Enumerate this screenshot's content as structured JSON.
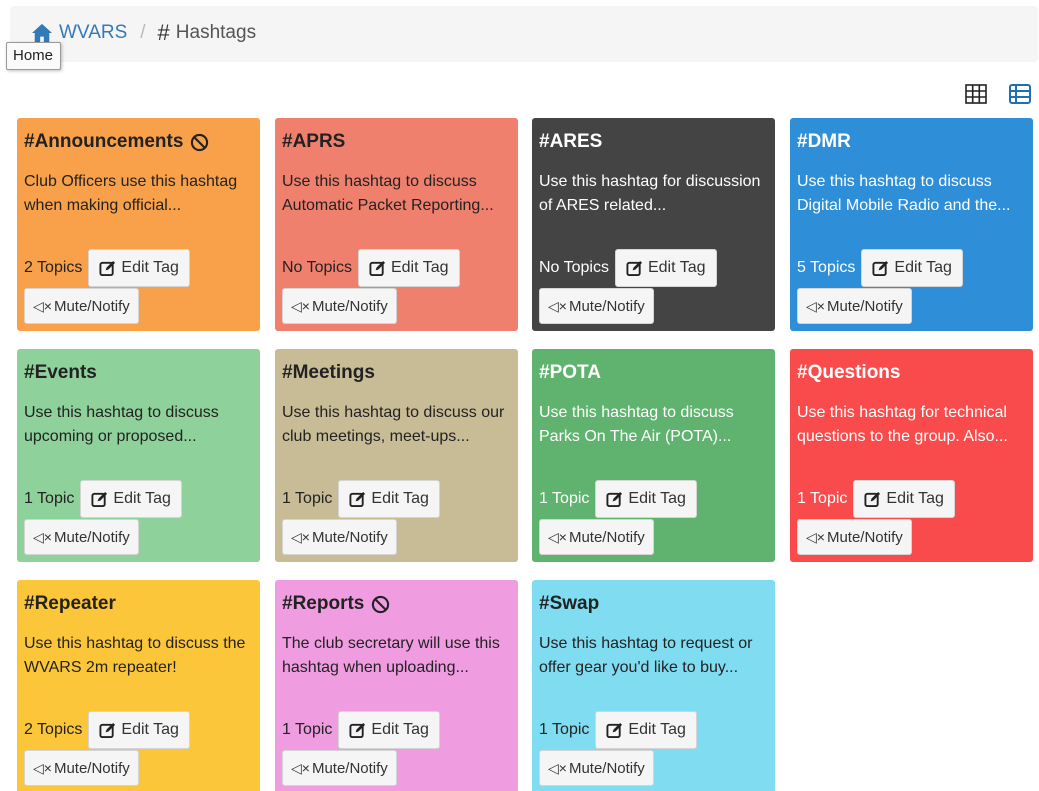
{
  "breadcrumb": {
    "home_label": "WVARS",
    "separator": "/",
    "current_label": "Hashtags"
  },
  "tooltip": {
    "text": "Home"
  },
  "view_toggle": {
    "grid_icon": "grid-icon",
    "list_icon": "list-icon",
    "active_color": "#1f6fb5"
  },
  "buttons": {
    "edit_label": "Edit Tag",
    "mute_label": "Mute/Notify"
  },
  "tags": [
    {
      "title": "#Announcements",
      "restricted": true,
      "desc": "Club Officers use this hashtag when making official...",
      "count": "2 Topics",
      "bg": "#f9a04a",
      "text_color": "#222222"
    },
    {
      "title": "#APRS",
      "restricted": false,
      "desc": "Use this hashtag to discuss Automatic Packet Reporting...",
      "count": "No Topics",
      "bg": "#f0806e",
      "text_color": "#222222"
    },
    {
      "title": "#ARES",
      "restricted": false,
      "desc": "Use this hashtag for discussion of ARES related...",
      "count": "No Topics",
      "bg": "#444444",
      "text_color": "#ffffff"
    },
    {
      "title": "#DMR",
      "restricted": false,
      "desc": "Use this hashtag to discuss Digital Mobile Radio and the...",
      "count": "5 Topics",
      "bg": "#2e8fd8",
      "text_color": "#ffffff"
    },
    {
      "title": "#Events",
      "restricted": false,
      "desc": "Use this hashtag to discuss upcoming or proposed...",
      "count": "1 Topic",
      "bg": "#8ed19a",
      "text_color": "#222222"
    },
    {
      "title": "#Meetings",
      "restricted": false,
      "desc": "Use this hashtag to discuss our club meetings, meet-ups...",
      "count": "1 Topic",
      "bg": "#c8bc96",
      "text_color": "#222222"
    },
    {
      "title": "#POTA",
      "restricted": false,
      "desc": "Use this hashtag to discuss Parks On The Air (POTA)...",
      "count": "1 Topic",
      "bg": "#5fb36e",
      "text_color": "#ffffff"
    },
    {
      "title": "#Questions",
      "restricted": false,
      "desc": "Use this hashtag for technical questions to the group. Also...",
      "count": "1 Topic",
      "bg": "#f94b4b",
      "text_color": "#ffffff"
    },
    {
      "title": "#Repeater",
      "restricted": false,
      "desc": "Use this hashtag to discuss the WVARS 2m repeater!",
      "count": "2 Topics",
      "bg": "#fbc63a",
      "text_color": "#222222"
    },
    {
      "title": "#Reports",
      "restricted": true,
      "desc": "The club secretary will use this hashtag when uploading...",
      "count": "1 Topic",
      "bg": "#f09ce0",
      "text_color": "#222222"
    },
    {
      "title": "#Swap",
      "restricted": false,
      "desc": "Use this hashtag to request or offer gear you'd like to buy...",
      "count": "1 Topic",
      "bg": "#80dcf1",
      "text_color": "#222222"
    }
  ]
}
